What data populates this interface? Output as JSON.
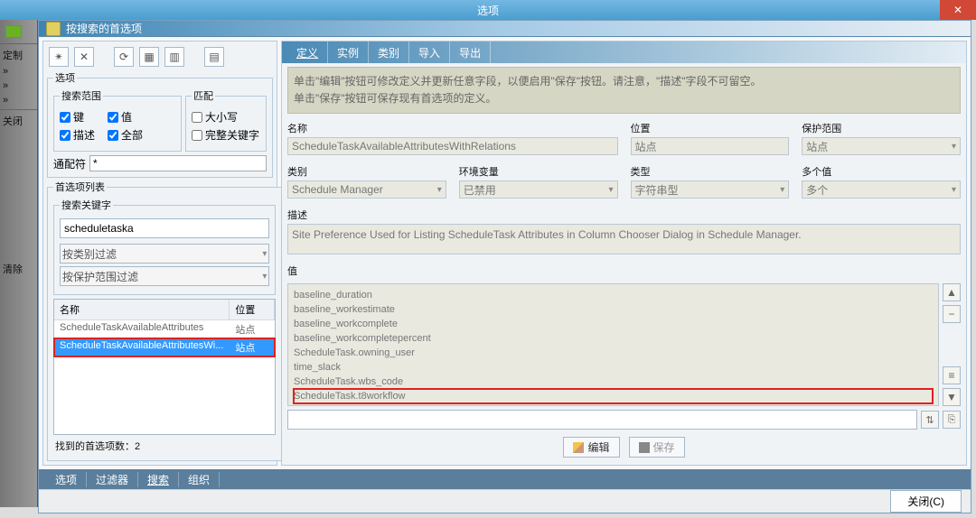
{
  "outer": {
    "title": "选项",
    "close": "✕"
  },
  "leftStrip": {
    "custom": "定制",
    "arrows": "»",
    "close": "关闭",
    "clear": "清除"
  },
  "dlg": {
    "title": "按搜索的首选项",
    "closeBtn": "关闭(C)"
  },
  "toolbar": {
    "i1": "✴",
    "i2": "✕",
    "i3": "⟳",
    "i4": "▦",
    "i5": "▥",
    "i6": "▤"
  },
  "options": {
    "legend": "选项",
    "scope": {
      "legend": "搜索范围",
      "key": "键",
      "value": "值",
      "desc": "描述",
      "all": "全部"
    },
    "match": {
      "legend": "匹配",
      "case": "大小写",
      "whole": "完整关键字"
    },
    "wildcard_label": "通配符",
    "wildcard_value": "*"
  },
  "prefList": {
    "legend": "首选项列表",
    "kw": {
      "legend": "搜索关键字",
      "value": "scheduletaska",
      "filterByCat": "按类别过滤",
      "filterByScope": "按保护范围过滤"
    },
    "th": {
      "name": "名称",
      "loc": "位置"
    },
    "rows": [
      {
        "name": "ScheduleTaskAvailableAttributes",
        "loc": "站点",
        "sel": false
      },
      {
        "name": "ScheduleTaskAvailableAttributesWi...",
        "loc": "站点",
        "sel": true
      }
    ],
    "found": "找到的首选项数：2"
  },
  "rightTabs": [
    "定义",
    "实例",
    "类别",
    "导入",
    "导出"
  ],
  "info": {
    "l1": "单击\"编辑\"按钮可修改定义并更新任意字段，以便启用\"保存\"按钮。请注意，\"描述\"字段不可留空。",
    "l2": "单击\"保存\"按钮可保存现有首选项的定义。"
  },
  "fields": {
    "name": {
      "label": "名称",
      "value": "ScheduleTaskAvailableAttributesWithRelations"
    },
    "loc": {
      "label": "位置",
      "value": "站点"
    },
    "protect": {
      "label": "保护范围",
      "value": "站点"
    },
    "cat": {
      "label": "类别",
      "value": "Schedule Manager"
    },
    "env": {
      "label": "环境变量",
      "value": "已禁用"
    },
    "type": {
      "label": "类型",
      "value": "字符串型"
    },
    "multi": {
      "label": "多个值",
      "value": "多个"
    },
    "desc": {
      "label": "描述",
      "value": "Site Preference Used for Listing ScheduleTask Attributes in Column Chooser Dialog in Schedule Manager."
    },
    "val": {
      "label": "值"
    }
  },
  "values": [
    "baseline_duration",
    "baseline_workestimate",
    "baseline_workcomplete",
    "baseline_workcompletepercent",
    "ScheduleTask.owning_user",
    "time_slack",
    "ScheduleTask.wbs_code",
    "ScheduleTask.t8workflow"
  ],
  "sideBtns": {
    "up": "▲",
    "minus": "−",
    "mid": "≡",
    "down": "▼",
    "sort": "⇅",
    "copy": "⎘"
  },
  "actions": {
    "edit": "编辑",
    "save": "保存"
  },
  "botTabs": [
    "选项",
    "过滤器",
    "搜索",
    "组织"
  ]
}
